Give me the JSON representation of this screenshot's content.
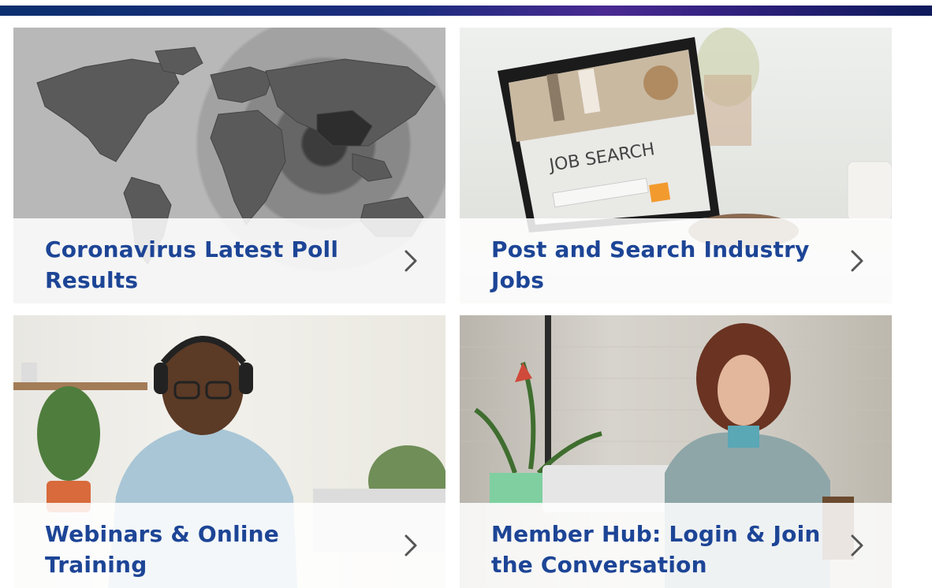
{
  "cards": [
    {
      "title": "Coronavirus Latest Poll Results",
      "image": "world-map-icon"
    },
    {
      "title": "Post and Search Industry Jobs",
      "image": "laptop-job-search-icon",
      "laptop_screen_text": "JOB SEARCH"
    },
    {
      "title": "Webinars & Online Training",
      "image": "man-headphones-icon"
    },
    {
      "title": "Member Hub: Login & Join the Conversation",
      "image": "woman-tablet-icon"
    }
  ],
  "colors": {
    "brand_blue": "#1d4596",
    "bar_start": "#0b2f6f",
    "bar_end": "#4a2a92"
  }
}
